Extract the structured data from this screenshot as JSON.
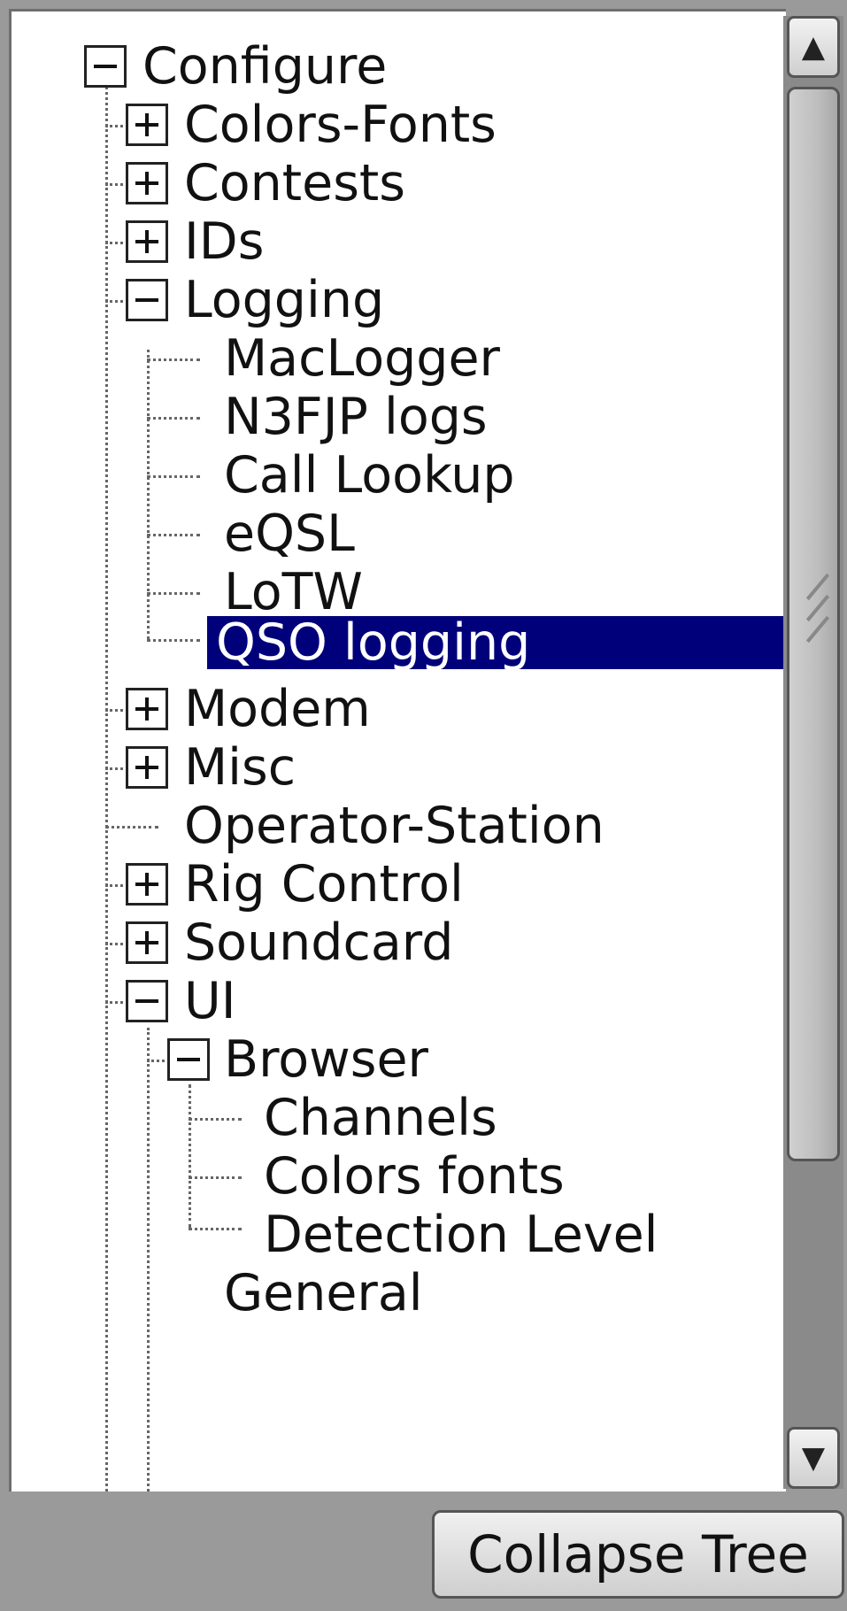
{
  "tree": {
    "root": {
      "label": "Configure",
      "expanded": true
    },
    "items": [
      {
        "label": "Colors-Fonts",
        "expanded": false
      },
      {
        "label": "Contests",
        "expanded": false
      },
      {
        "label": "IDs",
        "expanded": false
      },
      {
        "label": "Logging",
        "expanded": true,
        "children": [
          {
            "label": "MacLogger"
          },
          {
            "label": "N3FJP logs"
          },
          {
            "label": "Call Lookup"
          },
          {
            "label": "eQSL"
          },
          {
            "label": "LoTW"
          },
          {
            "label": "QSO logging",
            "selected": true
          }
        ]
      },
      {
        "label": "Modem",
        "expanded": false
      },
      {
        "label": "Misc",
        "expanded": false
      },
      {
        "label": "Operator-Station"
      },
      {
        "label": "Rig Control",
        "expanded": false
      },
      {
        "label": "Soundcard",
        "expanded": false
      },
      {
        "label": "UI",
        "expanded": true,
        "children": [
          {
            "label": "Browser",
            "expanded": true,
            "children": [
              {
                "label": "Channels"
              },
              {
                "label": "Colors fonts"
              },
              {
                "label": "Detection Level"
              }
            ]
          },
          {
            "label": "General"
          }
        ]
      }
    ]
  },
  "scrollbar": {
    "up_icon": "chevron-up",
    "down_icon": "chevron-down"
  },
  "buttons": {
    "collapse_tree": "Collapse Tree"
  },
  "colors": {
    "selection": "#00007a",
    "background": "#9a9a9a"
  }
}
